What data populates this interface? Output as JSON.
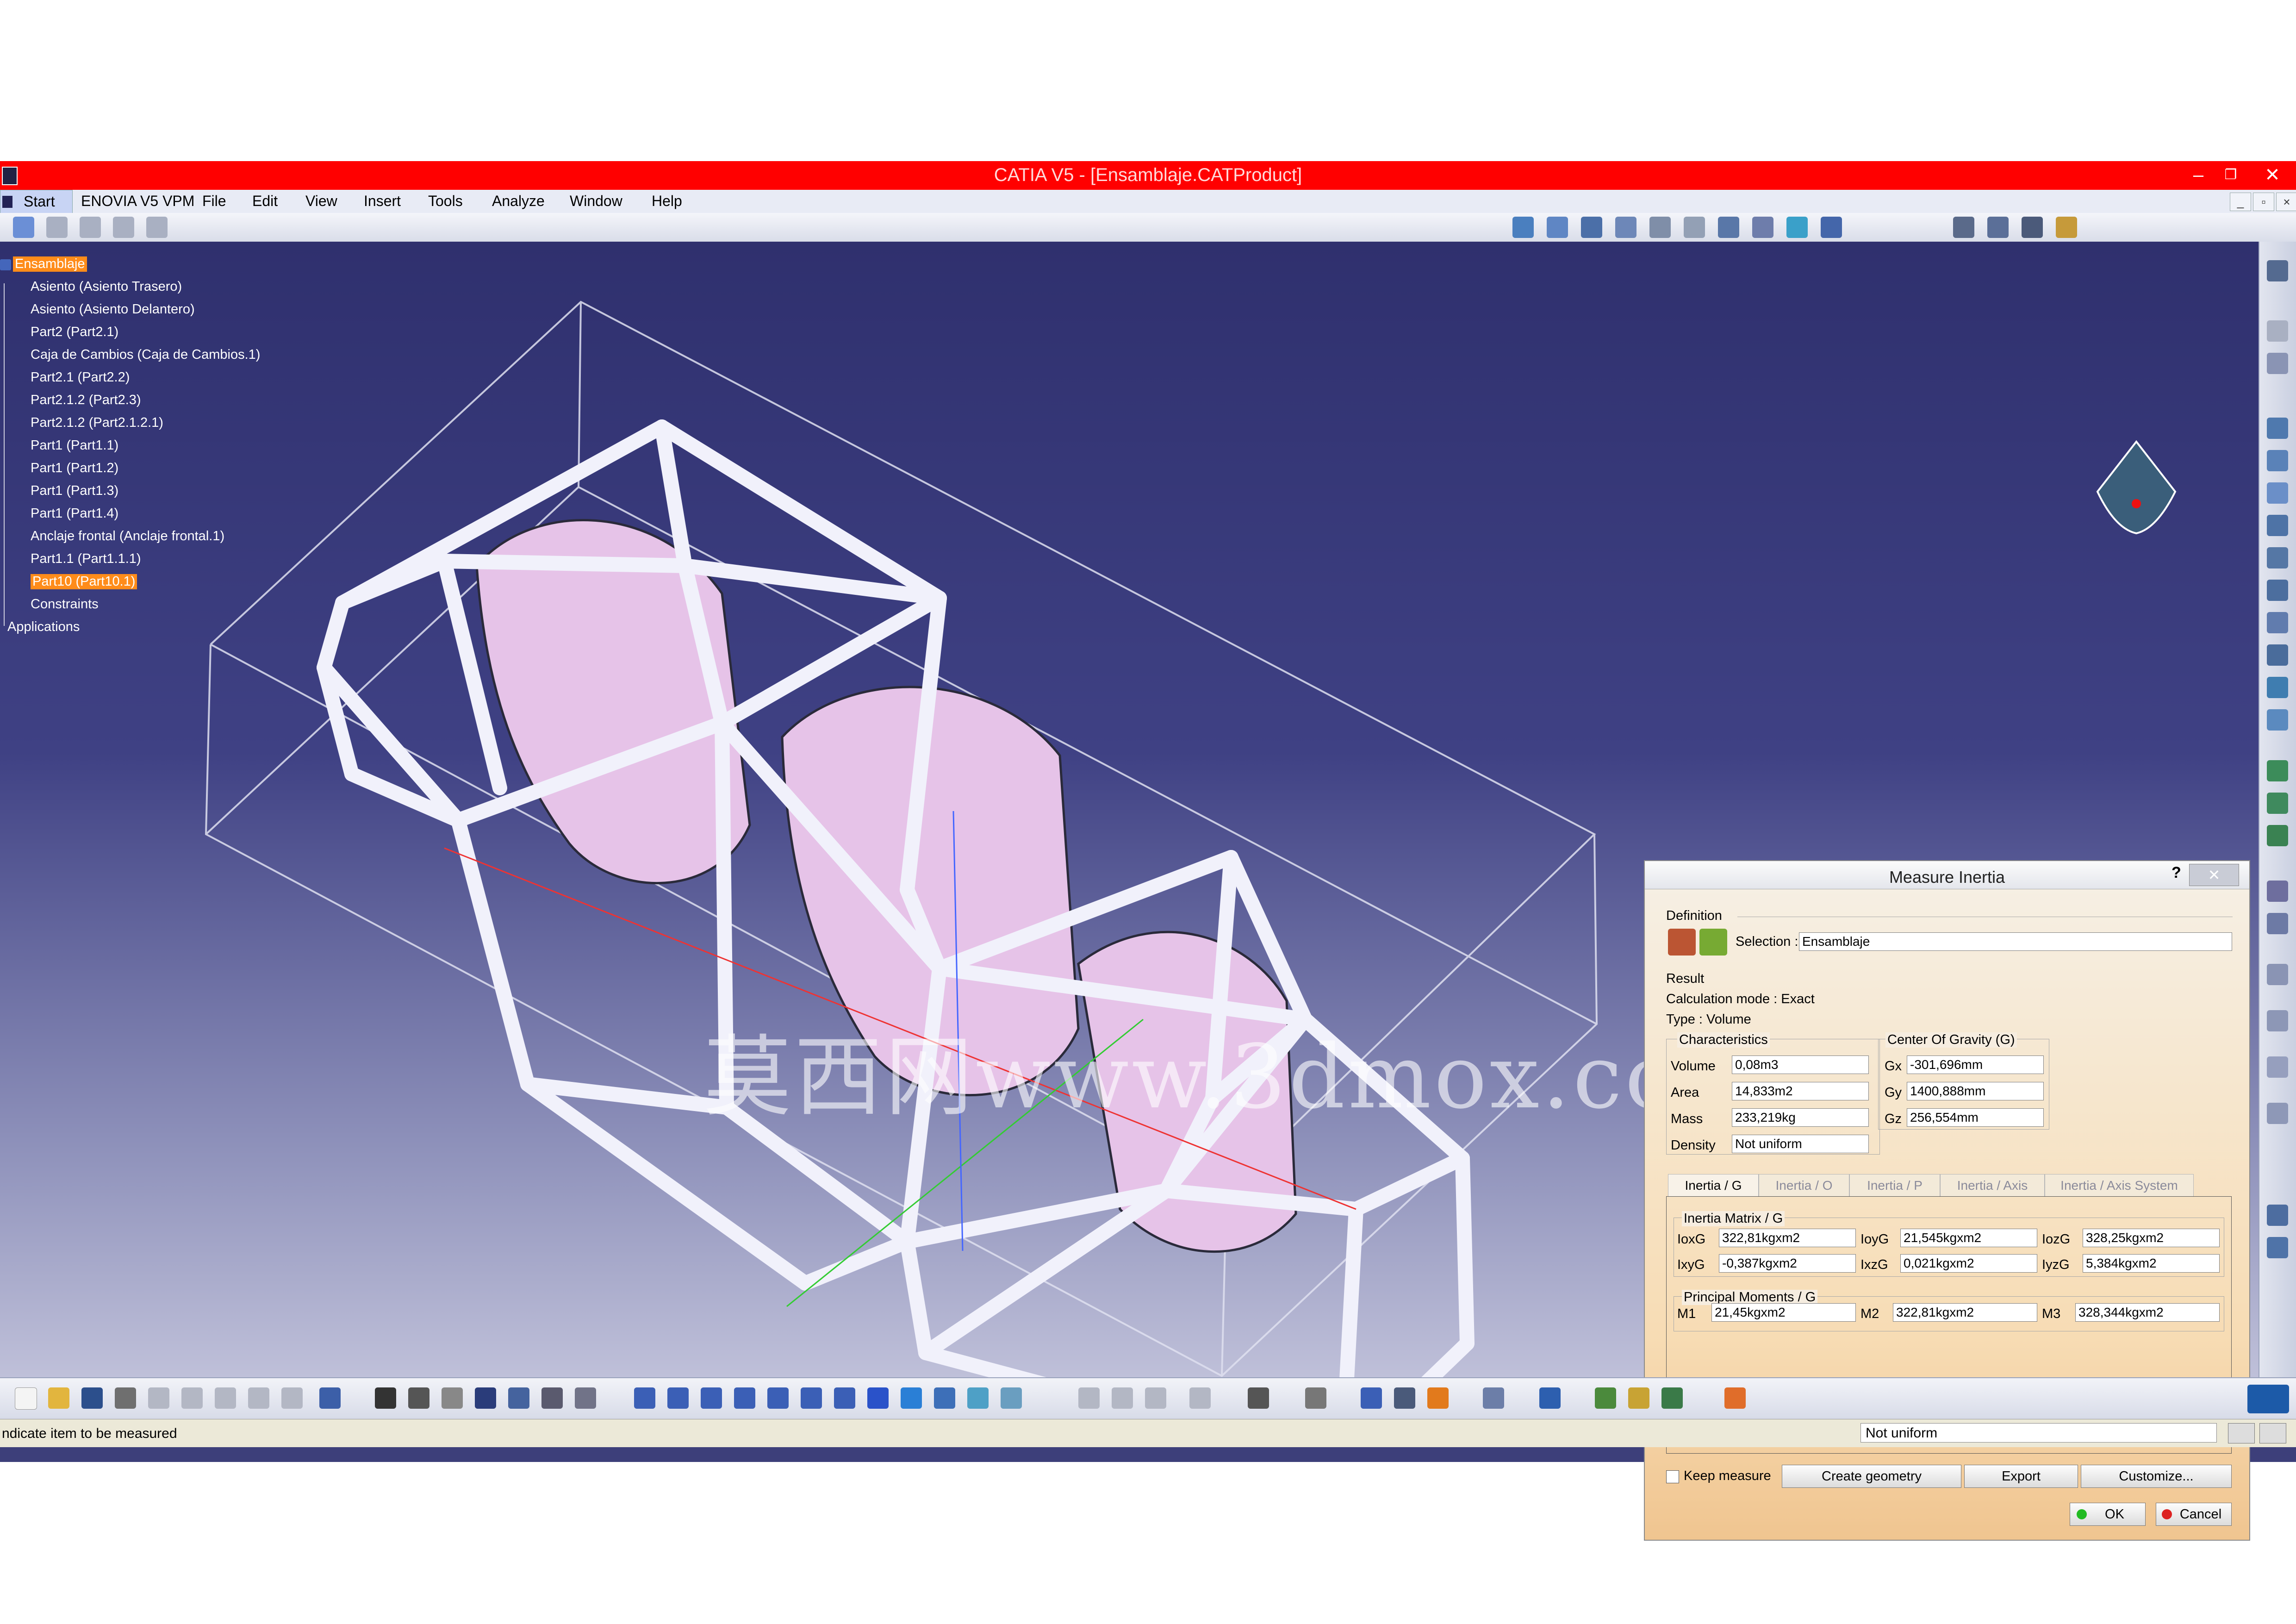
{
  "window": {
    "title": "CATIA V5 - [Ensamblaje.CATProduct]",
    "minimize": "–",
    "restore": "❐",
    "close": "✕"
  },
  "menu": {
    "items": [
      "Start",
      "ENOVIA V5 VPM",
      "File",
      "Edit",
      "View",
      "Insert",
      "Tools",
      "Analyze",
      "Window",
      "Help"
    ]
  },
  "tree": {
    "root": "Ensamblaje",
    "items": [
      "Asiento (Asiento Trasero)",
      "Asiento (Asiento Delantero)",
      "Part2 (Part2.1)",
      "Caja de Cambios (Caja de Cambios.1)",
      "Part2.1 (Part2.2)",
      "Part2.1.2 (Part2.3)",
      "Part2.1.2 (Part2.1.2.1)",
      "Part1 (Part1.1)",
      "Part1 (Part1.2)",
      "Part1 (Part1.3)",
      "Part1 (Part1.4)",
      "Anclaje frontal (Anclaje frontal.1)",
      "Part1.1 (Part1.1.1)",
      "Part10 (Part10.1)",
      "Constraints",
      "Applications"
    ],
    "highlighted_index": 13
  },
  "watermark": "莫西网www.3dmox.com",
  "dialog": {
    "title": "Measure Inertia",
    "help": "?",
    "close": "✕",
    "definition_label": "Definition",
    "selection_label": "Selection :",
    "selection_value": "Ensamblaje",
    "result_label": "Result",
    "calc_mode": "Calculation mode :  Exact",
    "type": "Type :  Volume",
    "characteristics": {
      "label": "Characteristics",
      "rows": [
        {
          "name": "Volume",
          "value": "0,08m3"
        },
        {
          "name": "Area",
          "value": "14,833m2"
        },
        {
          "name": "Mass",
          "value": "233,219kg"
        },
        {
          "name": "Density",
          "value": "Not uniform"
        }
      ]
    },
    "cog": {
      "label": "Center Of Gravity (G)",
      "rows": [
        {
          "name": "Gx",
          "value": "-301,696mm"
        },
        {
          "name": "Gy",
          "value": "1400,888mm"
        },
        {
          "name": "Gz",
          "value": "256,554mm"
        }
      ]
    },
    "tabs": [
      "Inertia / G",
      "Inertia / O",
      "Inertia / P",
      "Inertia / Axis",
      "Inertia / Axis System"
    ],
    "matrix": {
      "label": "Inertia Matrix / G",
      "rows": [
        [
          {
            "name": "IoxG",
            "value": "322,81kgxm2"
          },
          {
            "name": "IoyG",
            "value": "21,545kgxm2"
          },
          {
            "name": "IozG",
            "value": "328,25kgxm2"
          }
        ],
        [
          {
            "name": "IxyG",
            "value": "-0,387kgxm2"
          },
          {
            "name": "IxzG",
            "value": "0,021kgxm2"
          },
          {
            "name": "IyzG",
            "value": "5,384kgxm2"
          }
        ]
      ]
    },
    "principal": {
      "label": "Principal Moments / G",
      "items": [
        {
          "name": "M1",
          "value": "21,45kgxm2"
        },
        {
          "name": "M2",
          "value": "322,81kgxm2"
        },
        {
          "name": "M3",
          "value": "328,344kgxm2"
        }
      ]
    },
    "keep_measure": "Keep measure",
    "buttons": {
      "create": "Create geometry",
      "export": "Export",
      "customize": "Customize...",
      "ok": "OK",
      "cancel": "Cancel"
    }
  },
  "status": {
    "message": "ndicate item to be measured",
    "field": "Not uniform"
  },
  "colors": {
    "titlebar": "#ff0000",
    "viewport_top": "#2f306e",
    "tree_highlight": "#ff8c1a",
    "frame": "#e8e8f4",
    "seat": "#e7c2e6"
  }
}
